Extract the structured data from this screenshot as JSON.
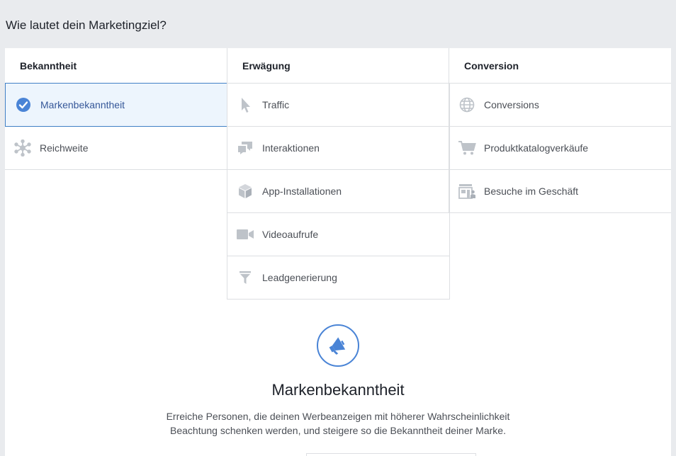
{
  "page_title": "Wie lautet dein Marketingziel?",
  "columns": [
    {
      "heading": "Bekanntheit",
      "items": [
        {
          "label": "Markenbekanntheit",
          "icon": "check-circle-icon",
          "selected": true
        },
        {
          "label": "Reichweite",
          "icon": "reach-icon",
          "selected": false
        }
      ]
    },
    {
      "heading": "Erwägung",
      "items": [
        {
          "label": "Traffic",
          "icon": "cursor-icon",
          "selected": false
        },
        {
          "label": "Interaktionen",
          "icon": "chat-bubbles-icon",
          "selected": false
        },
        {
          "label": "App-Installationen",
          "icon": "cube-icon",
          "selected": false
        },
        {
          "label": "Videoaufrufe",
          "icon": "video-camera-icon",
          "selected": false
        },
        {
          "label": "Leadgenerierung",
          "icon": "funnel-icon",
          "selected": false
        }
      ]
    },
    {
      "heading": "Conversion",
      "items": [
        {
          "label": "Conversions",
          "icon": "globe-icon",
          "selected": false
        },
        {
          "label": "Produktkatalogverkäufe",
          "icon": "shopping-cart-icon",
          "selected": false
        },
        {
          "label": "Besuche im Geschäft",
          "icon": "store-icon",
          "selected": false
        }
      ]
    }
  ],
  "detail": {
    "icon": "megaphone-icon",
    "title": "Markenbekanntheit",
    "description": "Erreiche Personen, die deinen Werbeanzeigen mit höherer Wahrscheinlichkeit Beachtung schenken werden, und steigere so die Bekanntheit deiner Marke."
  },
  "colors": {
    "accent": "#4a84d6",
    "selected_bg": "#edf5fd",
    "icon_gray": "#bec3c9"
  }
}
